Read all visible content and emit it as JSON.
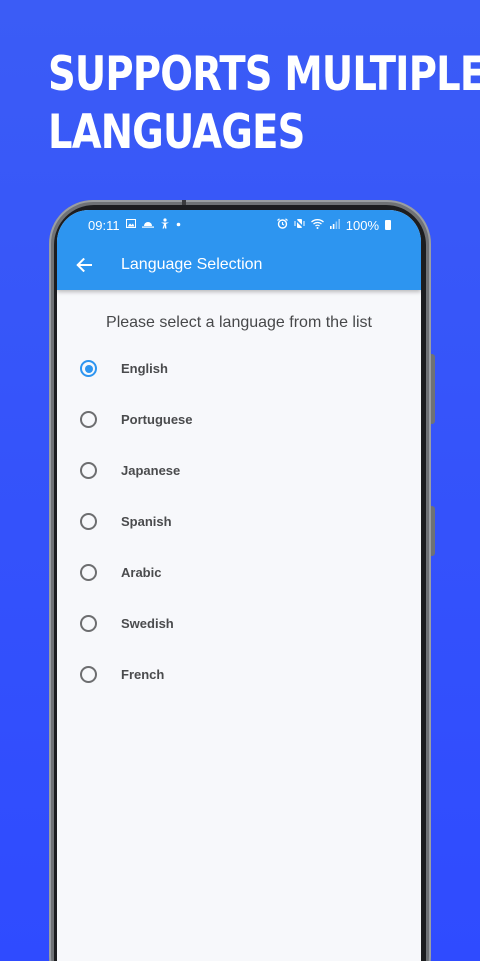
{
  "promo": {
    "line1": "SUPPORTS MULTIPLE",
    "line2": "LANGUAGES"
  },
  "status_bar": {
    "time": "09:11",
    "battery": "100%"
  },
  "toolbar": {
    "title": "Language Selection",
    "back_icon": "arrow-left-icon"
  },
  "prompt": "Please select a language from the list",
  "languages": [
    {
      "label": "English",
      "selected": true
    },
    {
      "label": "Portuguese",
      "selected": false
    },
    {
      "label": "Japanese",
      "selected": false
    },
    {
      "label": "Spanish",
      "selected": false
    },
    {
      "label": "Arabic",
      "selected": false
    },
    {
      "label": "Swedish",
      "selected": false
    },
    {
      "label": "French",
      "selected": false
    }
  ],
  "colors": {
    "background": "#3452fb",
    "appbar": "#2d95f0",
    "screen": "#f7f8fb",
    "radio_selected": "#2d95f0"
  }
}
